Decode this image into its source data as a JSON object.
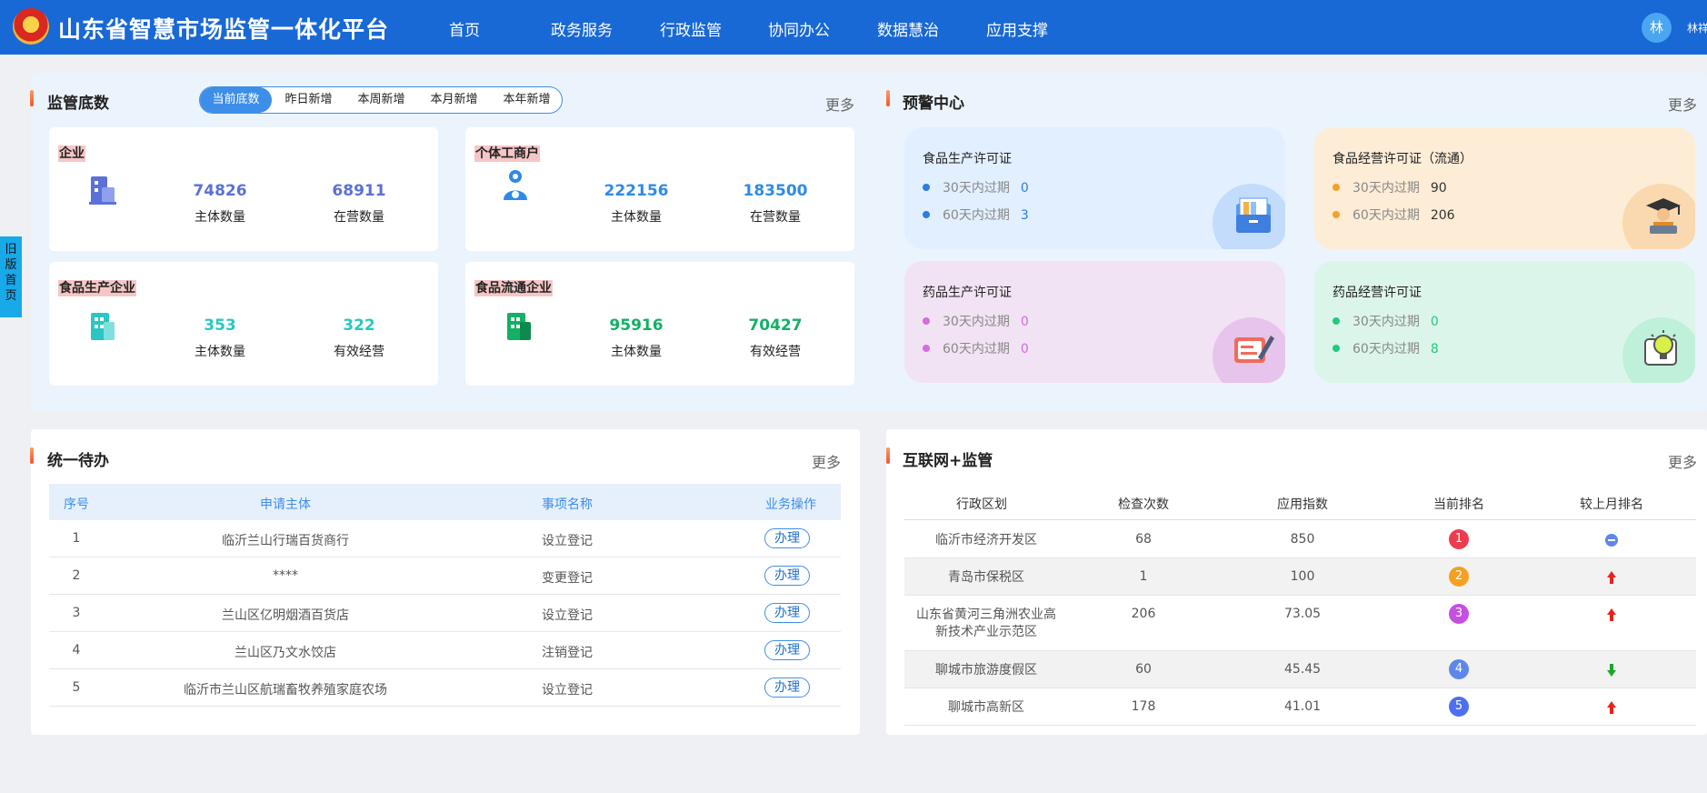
{
  "header": {
    "title": "山东省智慧市场监管一体化平台",
    "nav": [
      "首页",
      "政务服务",
      "行政监管",
      "协同办公",
      "数据慧治",
      "应用支撑"
    ],
    "avatar_text": "林",
    "username": "林祥"
  },
  "side_tab": {
    "label": "旧版首页"
  },
  "supervision": {
    "title": "监管底数",
    "more": "更多",
    "tabs": [
      "当前底数",
      "昨日新增",
      "本周新增",
      "本月新增",
      "本年新增"
    ],
    "active_tab": "当前底数",
    "cards": [
      {
        "label": "企业",
        "value1": "74826",
        "caption1": "主体数量",
        "value2": "68911",
        "caption2": "在营数量",
        "color": "#5b70d8",
        "icon": "building-icon"
      },
      {
        "label": "个体工商户",
        "value1": "222156",
        "caption1": "主体数量",
        "value2": "183500",
        "caption2": "在营数量",
        "color": "#2f8ae6",
        "icon": "person-icon"
      },
      {
        "label": "食品生产企业",
        "value1": "353",
        "caption1": "主体数量",
        "value2": "322",
        "caption2": "有效经营",
        "color": "#2bc6c3",
        "icon": "factory-icon"
      },
      {
        "label": "食品流通企业",
        "value1": "95916",
        "caption1": "主体数量",
        "value2": "70427",
        "caption2": "有效经营",
        "color": "#13b065",
        "icon": "store-icon"
      }
    ]
  },
  "warning": {
    "title": "预警中心",
    "more": "更多",
    "cards": [
      {
        "title": "食品生产许可证",
        "row1_label": "30天内过期",
        "row1_value": "0",
        "row2_label": "60天内过期",
        "row2_value": "3",
        "bg": "#e2efff",
        "dot": "#2a7de3",
        "value_color": "#2a7de3",
        "bubble": "#c4dcfb",
        "icon": "folder-icon"
      },
      {
        "title": "食品经营许可证（流通）",
        "row1_label": "30天内过期",
        "row1_value": "90",
        "row2_label": "60天内过期",
        "row2_value": "206",
        "bg": "#fdecd6",
        "dot": "#f3a12b",
        "value_color": "#333333",
        "bubble": "#fad9b0",
        "icon": "graduate-icon"
      },
      {
        "title": "药品生产许可证",
        "row1_label": "30天内过期",
        "row1_value": "0",
        "row2_label": "60天内过期",
        "row2_value": "0",
        "bg": "#f1e3f3",
        "dot": "#d56ae3",
        "value_color": "#d56ae3",
        "bubble": "#e6c4eb",
        "icon": "document-pen-icon"
      },
      {
        "title": "药品经营许可证",
        "row1_label": "30天内过期",
        "row1_value": "0",
        "row2_label": "60天内过期",
        "row2_value": "8",
        "bg": "#dcf5ea",
        "dot": "#23c97c",
        "value_color": "#23c97c",
        "bubble": "#bff0d9",
        "icon": "lightbulb-icon"
      }
    ]
  },
  "todo": {
    "title": "统一待办",
    "more": "更多",
    "columns": [
      "序号",
      "申请主体",
      "事项名称",
      "业务操作"
    ],
    "action_label": "办理",
    "rows": [
      {
        "no": "1",
        "subject": "临沂兰山行瑞百货商行",
        "item": "设立登记"
      },
      {
        "no": "2",
        "subject": "****",
        "item": "变更登记"
      },
      {
        "no": "3",
        "subject": "兰山区亿明烟酒百货店",
        "item": "设立登记"
      },
      {
        "no": "4",
        "subject": "兰山区乃文水饺店",
        "item": "注销登记"
      },
      {
        "no": "5",
        "subject": "临沂市兰山区航瑞畜牧养殖家庭农场",
        "item": "设立登记"
      }
    ]
  },
  "internet": {
    "title": "互联网+监管",
    "more": "更多",
    "columns": [
      "行政区划",
      "检查次数",
      "应用指数",
      "当前排名",
      "较上月排名"
    ],
    "rows": [
      {
        "region": "临沂市经济开发区",
        "region2": "",
        "checks": "68",
        "index": "850",
        "rank": "1",
        "trend": "same"
      },
      {
        "region": "青岛市保税区",
        "region2": "",
        "checks": "1",
        "index": "100",
        "rank": "2",
        "trend": "up"
      },
      {
        "region": "山东省黄河三角洲农业高",
        "region2": "新技术产业示范区",
        "checks": "206",
        "index": "73.05",
        "rank": "3",
        "trend": "up"
      },
      {
        "region": "聊城市旅游度假区",
        "region2": "",
        "checks": "60",
        "index": "45.45",
        "rank": "4",
        "trend": "down"
      },
      {
        "region": "聊城市高新区",
        "region2": "",
        "checks": "178",
        "index": "41.01",
        "rank": "5",
        "trend": "up"
      }
    ],
    "rank_colors": [
      "#ee3b50",
      "#f5a021",
      "#c54fe0",
      "#5d88ea",
      "#4f6ff0"
    ]
  }
}
